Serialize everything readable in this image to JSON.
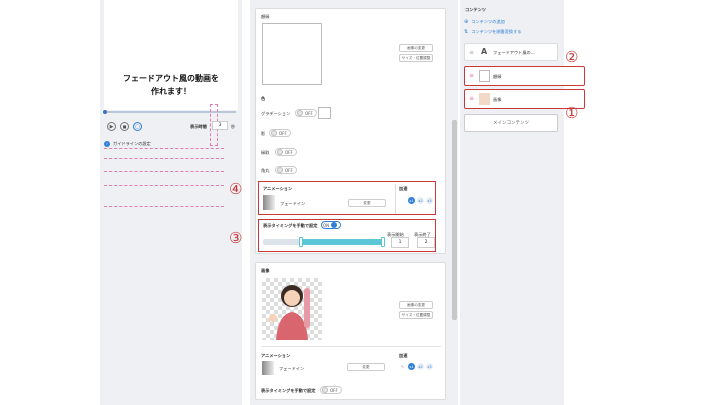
{
  "preview": {
    "title_line1": "フェードアウト風の動画を",
    "title_line2": "作れます！",
    "duration_label": "表示時間",
    "duration_value": "3",
    "duration_unit": "秒",
    "guideline_label": "ガイドラインの設定"
  },
  "middle": {
    "frame_label": "額縁",
    "change_button": "画像の変更",
    "size_button": "サイズ・位置調整",
    "color_label": "色",
    "gradient_label": "グラデーション",
    "off": "OFF",
    "on": "ON",
    "border_label": "影",
    "edge_label": "縁取",
    "corner_label": "角丸",
    "animation_label": "アニメーション",
    "fade_in": "フェードイン",
    "change": "変更",
    "speed_label": "加速",
    "timing_label": "表示タイミングを手動で設定",
    "start_label": "表示開始",
    "end_label": "表示終了",
    "start_value": "1",
    "end_value": "2",
    "image_label": "画像",
    "speed_options": [
      "x1",
      "x2",
      "x3"
    ]
  },
  "right": {
    "section_title": "コンテンツ",
    "add_content": "コンテンツの追加",
    "reorder_content": "コンテンツを順番変換する",
    "items": [
      {
        "label": "フェードアウト風の..."
      },
      {
        "label": "額縁"
      },
      {
        "label": "画像"
      }
    ],
    "main_content_button": "メインコンテンツ"
  },
  "annotations": {
    "n1": "①",
    "n2": "②",
    "n3": "③",
    "n4": "④"
  },
  "colors": {
    "accent": "#5bc6d6",
    "annotation": "#c83a3a",
    "primary": "#2f7fd6"
  }
}
